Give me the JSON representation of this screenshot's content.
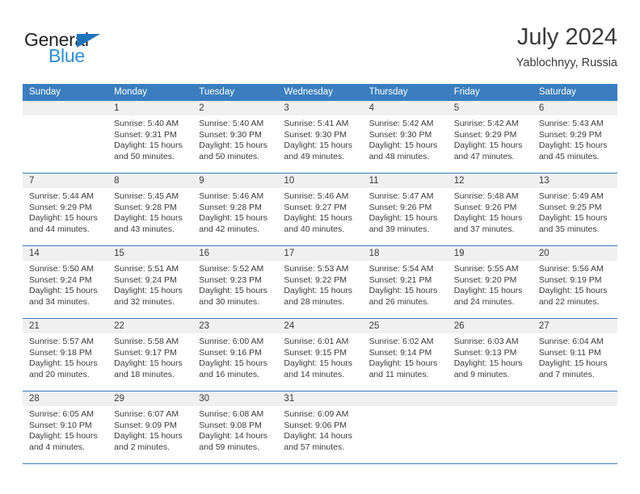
{
  "brand": {
    "name_part1": "General",
    "name_part2": "Blue",
    "color_dark": "#231f20",
    "color_blue": "#2b8fd4",
    "triangle_color": "#1b75bb"
  },
  "header": {
    "month_title": "July 2024",
    "location": "Yablochnyy, Russia"
  },
  "theme": {
    "header_blue": "#3a7ebf",
    "daynum_band": "#f0f0f0",
    "text": "#3b3b3b"
  },
  "weekdays": [
    "Sunday",
    "Monday",
    "Tuesday",
    "Wednesday",
    "Thursday",
    "Friday",
    "Saturday"
  ],
  "weeks": [
    [
      {
        "day": "",
        "sunrise": "",
        "sunset": "",
        "daylight1": "",
        "daylight2": ""
      },
      {
        "day": "1",
        "sunrise": "Sunrise: 5:40 AM",
        "sunset": "Sunset: 9:31 PM",
        "daylight1": "Daylight: 15 hours",
        "daylight2": "and 50 minutes."
      },
      {
        "day": "2",
        "sunrise": "Sunrise: 5:40 AM",
        "sunset": "Sunset: 9:30 PM",
        "daylight1": "Daylight: 15 hours",
        "daylight2": "and 50 minutes."
      },
      {
        "day": "3",
        "sunrise": "Sunrise: 5:41 AM",
        "sunset": "Sunset: 9:30 PM",
        "daylight1": "Daylight: 15 hours",
        "daylight2": "and 49 minutes."
      },
      {
        "day": "4",
        "sunrise": "Sunrise: 5:42 AM",
        "sunset": "Sunset: 9:30 PM",
        "daylight1": "Daylight: 15 hours",
        "daylight2": "and 48 minutes."
      },
      {
        "day": "5",
        "sunrise": "Sunrise: 5:42 AM",
        "sunset": "Sunset: 9:29 PM",
        "daylight1": "Daylight: 15 hours",
        "daylight2": "and 47 minutes."
      },
      {
        "day": "6",
        "sunrise": "Sunrise: 5:43 AM",
        "sunset": "Sunset: 9:29 PM",
        "daylight1": "Daylight: 15 hours",
        "daylight2": "and 45 minutes."
      }
    ],
    [
      {
        "day": "7",
        "sunrise": "Sunrise: 5:44 AM",
        "sunset": "Sunset: 9:29 PM",
        "daylight1": "Daylight: 15 hours",
        "daylight2": "and 44 minutes."
      },
      {
        "day": "8",
        "sunrise": "Sunrise: 5:45 AM",
        "sunset": "Sunset: 9:28 PM",
        "daylight1": "Daylight: 15 hours",
        "daylight2": "and 43 minutes."
      },
      {
        "day": "9",
        "sunrise": "Sunrise: 5:46 AM",
        "sunset": "Sunset: 9:28 PM",
        "daylight1": "Daylight: 15 hours",
        "daylight2": "and 42 minutes."
      },
      {
        "day": "10",
        "sunrise": "Sunrise: 5:46 AM",
        "sunset": "Sunset: 9:27 PM",
        "daylight1": "Daylight: 15 hours",
        "daylight2": "and 40 minutes."
      },
      {
        "day": "11",
        "sunrise": "Sunrise: 5:47 AM",
        "sunset": "Sunset: 9:26 PM",
        "daylight1": "Daylight: 15 hours",
        "daylight2": "and 39 minutes."
      },
      {
        "day": "12",
        "sunrise": "Sunrise: 5:48 AM",
        "sunset": "Sunset: 9:26 PM",
        "daylight1": "Daylight: 15 hours",
        "daylight2": "and 37 minutes."
      },
      {
        "day": "13",
        "sunrise": "Sunrise: 5:49 AM",
        "sunset": "Sunset: 9:25 PM",
        "daylight1": "Daylight: 15 hours",
        "daylight2": "and 35 minutes."
      }
    ],
    [
      {
        "day": "14",
        "sunrise": "Sunrise: 5:50 AM",
        "sunset": "Sunset: 9:24 PM",
        "daylight1": "Daylight: 15 hours",
        "daylight2": "and 34 minutes."
      },
      {
        "day": "15",
        "sunrise": "Sunrise: 5:51 AM",
        "sunset": "Sunset: 9:24 PM",
        "daylight1": "Daylight: 15 hours",
        "daylight2": "and 32 minutes."
      },
      {
        "day": "16",
        "sunrise": "Sunrise: 5:52 AM",
        "sunset": "Sunset: 9:23 PM",
        "daylight1": "Daylight: 15 hours",
        "daylight2": "and 30 minutes."
      },
      {
        "day": "17",
        "sunrise": "Sunrise: 5:53 AM",
        "sunset": "Sunset: 9:22 PM",
        "daylight1": "Daylight: 15 hours",
        "daylight2": "and 28 minutes."
      },
      {
        "day": "18",
        "sunrise": "Sunrise: 5:54 AM",
        "sunset": "Sunset: 9:21 PM",
        "daylight1": "Daylight: 15 hours",
        "daylight2": "and 26 minutes."
      },
      {
        "day": "19",
        "sunrise": "Sunrise: 5:55 AM",
        "sunset": "Sunset: 9:20 PM",
        "daylight1": "Daylight: 15 hours",
        "daylight2": "and 24 minutes."
      },
      {
        "day": "20",
        "sunrise": "Sunrise: 5:56 AM",
        "sunset": "Sunset: 9:19 PM",
        "daylight1": "Daylight: 15 hours",
        "daylight2": "and 22 minutes."
      }
    ],
    [
      {
        "day": "21",
        "sunrise": "Sunrise: 5:57 AM",
        "sunset": "Sunset: 9:18 PM",
        "daylight1": "Daylight: 15 hours",
        "daylight2": "and 20 minutes."
      },
      {
        "day": "22",
        "sunrise": "Sunrise: 5:58 AM",
        "sunset": "Sunset: 9:17 PM",
        "daylight1": "Daylight: 15 hours",
        "daylight2": "and 18 minutes."
      },
      {
        "day": "23",
        "sunrise": "Sunrise: 6:00 AM",
        "sunset": "Sunset: 9:16 PM",
        "daylight1": "Daylight: 15 hours",
        "daylight2": "and 16 minutes."
      },
      {
        "day": "24",
        "sunrise": "Sunrise: 6:01 AM",
        "sunset": "Sunset: 9:15 PM",
        "daylight1": "Daylight: 15 hours",
        "daylight2": "and 14 minutes."
      },
      {
        "day": "25",
        "sunrise": "Sunrise: 6:02 AM",
        "sunset": "Sunset: 9:14 PM",
        "daylight1": "Daylight: 15 hours",
        "daylight2": "and 11 minutes."
      },
      {
        "day": "26",
        "sunrise": "Sunrise: 6:03 AM",
        "sunset": "Sunset: 9:13 PM",
        "daylight1": "Daylight: 15 hours",
        "daylight2": "and 9 minutes."
      },
      {
        "day": "27",
        "sunrise": "Sunrise: 6:04 AM",
        "sunset": "Sunset: 9:11 PM",
        "daylight1": "Daylight: 15 hours",
        "daylight2": "and 7 minutes."
      }
    ],
    [
      {
        "day": "28",
        "sunrise": "Sunrise: 6:05 AM",
        "sunset": "Sunset: 9:10 PM",
        "daylight1": "Daylight: 15 hours",
        "daylight2": "and 4 minutes."
      },
      {
        "day": "29",
        "sunrise": "Sunrise: 6:07 AM",
        "sunset": "Sunset: 9:09 PM",
        "daylight1": "Daylight: 15 hours",
        "daylight2": "and 2 minutes."
      },
      {
        "day": "30",
        "sunrise": "Sunrise: 6:08 AM",
        "sunset": "Sunset: 9:08 PM",
        "daylight1": "Daylight: 14 hours",
        "daylight2": "and 59 minutes."
      },
      {
        "day": "31",
        "sunrise": "Sunrise: 6:09 AM",
        "sunset": "Sunset: 9:06 PM",
        "daylight1": "Daylight: 14 hours",
        "daylight2": "and 57 minutes."
      },
      {
        "day": "",
        "sunrise": "",
        "sunset": "",
        "daylight1": "",
        "daylight2": ""
      },
      {
        "day": "",
        "sunrise": "",
        "sunset": "",
        "daylight1": "",
        "daylight2": ""
      },
      {
        "day": "",
        "sunrise": "",
        "sunset": "",
        "daylight1": "",
        "daylight2": ""
      }
    ]
  ]
}
